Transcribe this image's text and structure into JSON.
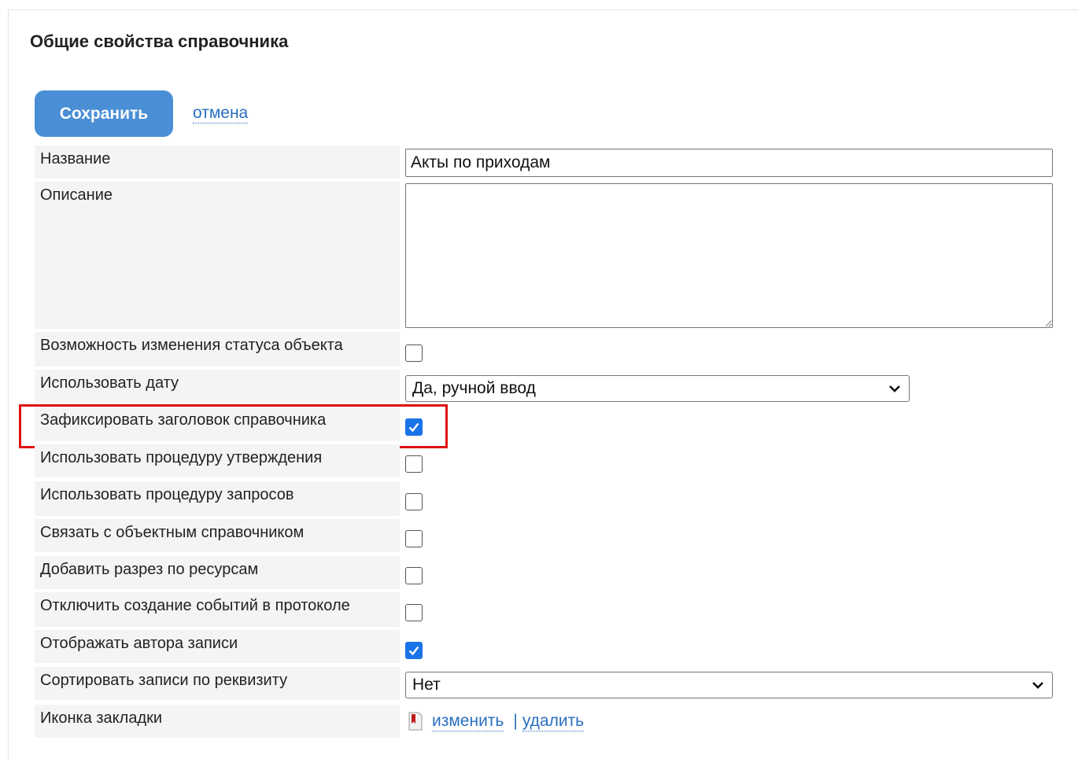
{
  "form": {
    "title": "Общие свойства справочника",
    "save_label": "Сохранить",
    "cancel_label": "отмена"
  },
  "fields": {
    "name": {
      "label": "Название",
      "value": "Акты по приходам"
    },
    "description": {
      "label": "Описание",
      "value": ""
    },
    "status_change": {
      "label": "Возможность изменения статуса объекта",
      "checked": false
    },
    "use_date": {
      "label": "Использовать дату",
      "value": "Да, ручной ввод"
    },
    "fix_header": {
      "label": "Зафиксировать заголовок справочника",
      "checked": true
    },
    "approval": {
      "label": "Использовать процедуру утверждения",
      "checked": false
    },
    "requests": {
      "label": "Использовать процедуру запросов",
      "checked": false
    },
    "link_object": {
      "label": "Связать с объектным справочником",
      "checked": false
    },
    "resources": {
      "label": "Добавить разрез по ресурсам",
      "checked": false
    },
    "disable_events": {
      "label": "Отключить создание событий в протоколе",
      "checked": false
    },
    "show_author": {
      "label": "Отображать автора записи",
      "checked": true
    },
    "sort_by": {
      "label": "Сортировать записи по реквизиту",
      "value": "Нет"
    },
    "tab_icon": {
      "label": "Иконка закладки",
      "change_label": "изменить",
      "separator": "|",
      "delete_label": "удалить"
    }
  },
  "colors": {
    "accent": "#4a8fd6",
    "link": "#2a6fc0",
    "highlight": "#e01010",
    "checkbox_checked": "#1a73e8",
    "label_bg": "#f4f4f4"
  }
}
